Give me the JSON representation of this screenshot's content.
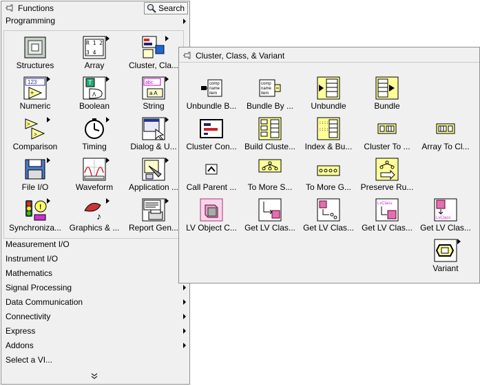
{
  "functions_palette": {
    "title": "Functions",
    "search_label": "Search",
    "section": "Programming",
    "items": [
      {
        "label": "Structures",
        "icon": "structures-icon",
        "submenu": false
      },
      {
        "label": "Array",
        "icon": "array-icon",
        "submenu": true
      },
      {
        "label": "Cluster, Cla...",
        "icon": "cluster-class-icon",
        "submenu": true
      },
      {
        "label": "Numeric",
        "icon": "numeric-icon",
        "submenu": true
      },
      {
        "label": "Boolean",
        "icon": "boolean-icon",
        "submenu": true
      },
      {
        "label": "String",
        "icon": "string-icon",
        "submenu": true
      },
      {
        "label": "Comparison",
        "icon": "comparison-icon",
        "submenu": true
      },
      {
        "label": "Timing",
        "icon": "timing-icon",
        "submenu": true
      },
      {
        "label": "Dialog & U...",
        "icon": "dialog-icon",
        "submenu": true
      },
      {
        "label": "File I/O",
        "icon": "file-io-icon",
        "submenu": true
      },
      {
        "label": "Waveform",
        "icon": "waveform-icon",
        "submenu": true
      },
      {
        "label": "Application ...",
        "icon": "application-icon",
        "submenu": true
      },
      {
        "label": "Synchroniza...",
        "icon": "synchronization-icon",
        "submenu": true
      },
      {
        "label": "Graphics & ...",
        "icon": "graphics-icon",
        "submenu": true
      },
      {
        "label": "Report Gen...",
        "icon": "report-icon",
        "submenu": true
      }
    ],
    "categories": [
      {
        "label": "Measurement I/O",
        "submenu": true
      },
      {
        "label": "Instrument I/O",
        "submenu": true
      },
      {
        "label": "Mathematics",
        "submenu": true
      },
      {
        "label": "Signal Processing",
        "submenu": true
      },
      {
        "label": "Data Communication",
        "submenu": true
      },
      {
        "label": "Connectivity",
        "submenu": true
      },
      {
        "label": "Express",
        "submenu": true
      },
      {
        "label": "Addons",
        "submenu": true
      },
      {
        "label": "Select a VI...",
        "submenu": false
      }
    ]
  },
  "cluster_palette": {
    "title": "Cluster, Class, & Variant",
    "items": [
      {
        "label": "Unbundle B...",
        "icon": "unbundle-by-name-icon"
      },
      {
        "label": "Bundle By ...",
        "icon": "bundle-by-name-icon"
      },
      {
        "label": "Unbundle",
        "icon": "unbundle-icon"
      },
      {
        "label": "Bundle",
        "icon": "bundle-icon"
      },
      {
        "label": "",
        "icon": ""
      },
      {
        "label": "Cluster Con...",
        "icon": "cluster-constant-icon"
      },
      {
        "label": "Build Cluste...",
        "icon": "build-cluster-array-icon"
      },
      {
        "label": "Index & Bu...",
        "icon": "index-bundle-icon"
      },
      {
        "label": "Cluster To ...",
        "icon": "cluster-to-array-icon"
      },
      {
        "label": "Array To Cl...",
        "icon": "array-to-cluster-icon"
      },
      {
        "label": "Call Parent ...",
        "icon": "call-parent-icon"
      },
      {
        "label": "To More S...",
        "icon": "to-more-specific-icon"
      },
      {
        "label": "To More G...",
        "icon": "to-more-generic-icon"
      },
      {
        "label": "Preserve Ru...",
        "icon": "preserve-runtime-class-icon"
      },
      {
        "label": "",
        "icon": ""
      },
      {
        "label": "LV Object C...",
        "icon": "lv-object-constant-icon"
      },
      {
        "label": "Get LV Clas...",
        "icon": "get-lv-class-default-icon"
      },
      {
        "label": "Get LV Clas...",
        "icon": "get-lv-class-path-icon"
      },
      {
        "label": "Get LV Clas...",
        "icon": "get-lv-class-name-icon"
      },
      {
        "label": "Get LV Clas...",
        "icon": "get-lv-class-info-icon"
      },
      {
        "label": "Variant",
        "icon": "variant-icon",
        "submenu": true
      }
    ]
  },
  "colors": {
    "panel_bg": "#f0f0f0",
    "icon_yellow": "#ffff99",
    "variant_pink": "#e8a0c8",
    "class_magenta": "#cc3399"
  }
}
